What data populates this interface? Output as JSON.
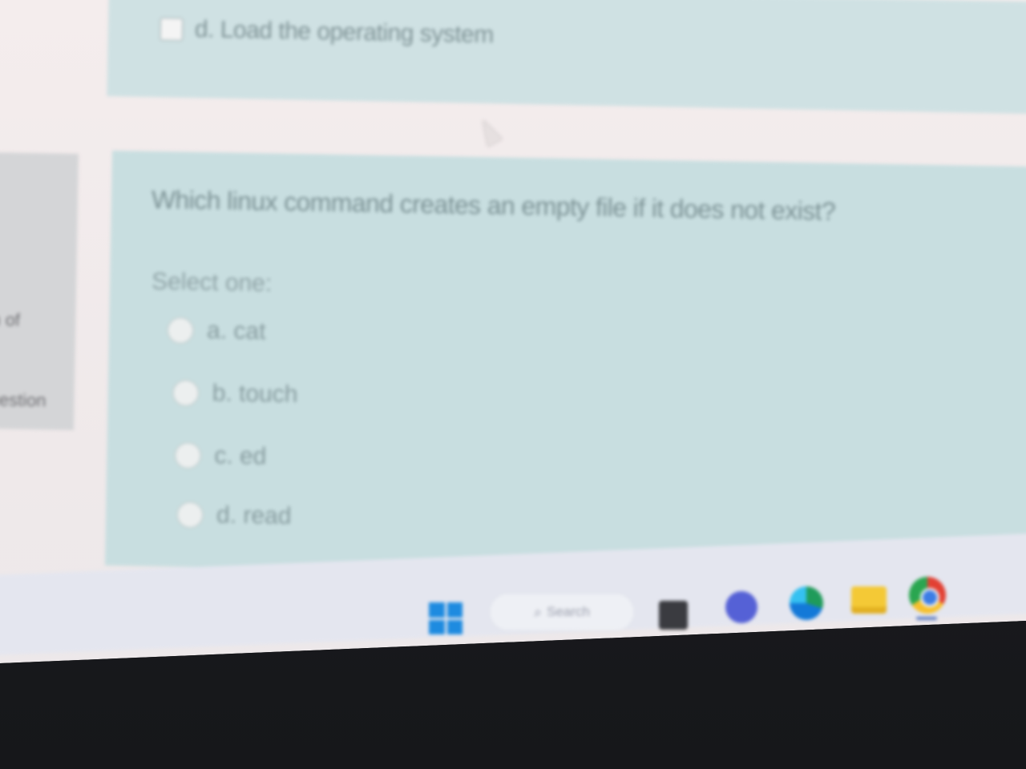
{
  "previous_question": {
    "option_d": "d. Load the operating system"
  },
  "nav_panel": {
    "fragment_1": "n of",
    "fragment_2": "uestion"
  },
  "question": {
    "text": "Which linux command creates an empty file if it does not exist?",
    "prompt": "Select one:",
    "options": [
      {
        "label": "a. cat"
      },
      {
        "label": "b. touch"
      },
      {
        "label": "c. ed"
      },
      {
        "label": "d. read"
      }
    ]
  },
  "taskbar": {
    "search_label": "Search",
    "icons": [
      "windows-start-icon",
      "search-icon",
      "photos-icon",
      "chat-icon",
      "edge-icon",
      "file-explorer-icon",
      "chrome-icon"
    ],
    "colors": {
      "start": "#1e8be0",
      "bar": "#e4e6ef"
    }
  },
  "colors": {
    "card_background": "#c8dee0",
    "page_background": "#f4eded"
  }
}
